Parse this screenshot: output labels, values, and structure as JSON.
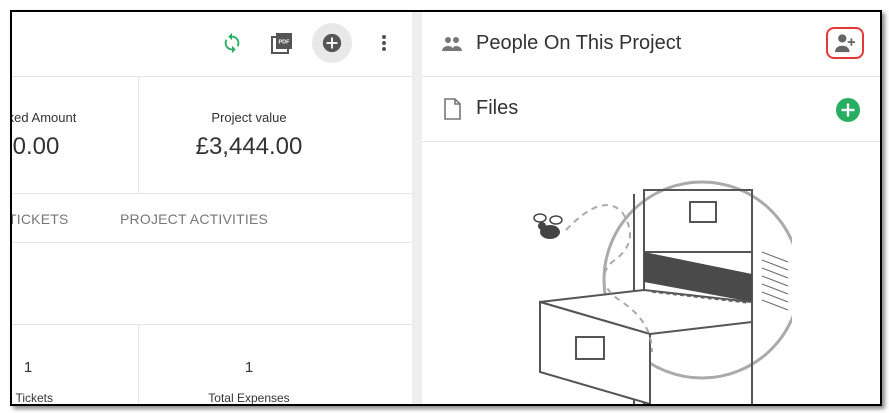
{
  "toolbar": {
    "icons": [
      "refresh-icon",
      "pdf-icon",
      "add-icon",
      "more-vert-icon"
    ],
    "pdf_text": "PDF"
  },
  "stats": {
    "left": {
      "label": "ked Amount",
      "value": "0.00"
    },
    "right": {
      "label": "Project value",
      "value": "£3,444.00"
    }
  },
  "tabs": [
    "TICKETS",
    "PROJECT ACTIVITIES"
  ],
  "bottom_stats": [
    {
      "value": "1",
      "label": "al Tickets"
    },
    {
      "value": "1",
      "label": "Total Expenses"
    }
  ],
  "people": {
    "title": "People On This Project"
  },
  "files": {
    "title": "Files"
  },
  "colors": {
    "green": "#27ae60",
    "red_highlight": "#e53935",
    "icon_gray": "#555555"
  }
}
